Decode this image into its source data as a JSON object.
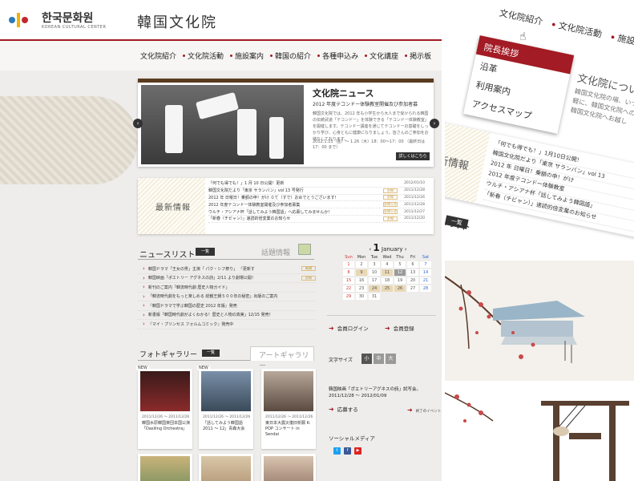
{
  "header": {
    "logo_ko": "한국문화원",
    "logo_en": "KOREAN CULTURAL CENTER",
    "title": "韓国文化院"
  },
  "nav": [
    "文化院紹介",
    "文化院活動",
    "施設案内",
    "韓国の紹介",
    "各種申込み",
    "文化講座",
    "掲示板"
  ],
  "hero": {
    "title": "文化院ニュース",
    "subtitle": "2012 年度テコンドー体験教室開催及び参加者募",
    "body": "韓国文化院では、2012 年も小学生から大人まで受けられる韓国の伝統武道「テコンドー」を体験できる「テコンドー体験教室」を開催します。テコンドー講座を通じてテコンドーの基礎をしっかり学び、心身ともに健康になりましょう。皆さんのご参加をお待ちしております。",
    "date": "2012.1.13（金）～ 1.26（木）18：00～17：00 （最終日は 17：00 まで）",
    "button": "詳しくはこちら"
  },
  "latest": {
    "label": "最新情報",
    "items": [
      {
        "title": "「何でも得でも！」1 月 10 日公開！更新",
        "tag": "",
        "date": "2012/01/10"
      },
      {
        "title": "韓国文化院だより「東京 サランバン」vol 13 号発行",
        "tag": "お知",
        "date": "2011/12/28"
      },
      {
        "title": "2012 年 日曜日！乗額の申！がけ ０て（すで）おめでとうございます！",
        "tag": "お知",
        "date": "2011/12/26"
      },
      {
        "title": "2012 年度テコンドー体験教室開催及び参加者募集",
        "tag": "お知らせ",
        "date": "2011/12/28"
      },
      {
        "title": "ウルチ・アシアナ杯「話してみよう韓国語」へ応募してみませんか！",
        "tag": "お知らせ",
        "date": "2011/12/27"
      },
      {
        "title": "「新春（チビャン）」速読的倍変業のお知らせ",
        "tag": "お知",
        "date": "2011/12/20"
      }
    ]
  },
  "newslist": {
    "title": "ニュースリスト",
    "button": "一覧",
    "topic": "話題情報",
    "items": [
      {
        "title": "韓国ドラマ「王女の男」主演「 パク・シフ祭り」 『更新す",
        "tag": "新規"
      },
      {
        "title": "韓国映画「ポエトリー アグネスの詩」2/11 より劇場公開！",
        "tag": "お知"
      },
      {
        "title": "新刊のご案内「韓流時代劇 歴史人物ガイド」",
        "tag": ""
      },
      {
        "title": "「韓流時代劇をもっと楽しめる 総観王朝５００年の秘密」出版のご案内",
        "tag": ""
      },
      {
        "title": "『韓国ドラマで学ぶ韓国の歴史 2012 年版』発売",
        "tag": ""
      },
      {
        "title": "新書版「韓国時代劇がよくわかる！歴史と人物の真実」12/15 発売！",
        "tag": ""
      },
      {
        "title": "『マイ・プリンセス フォルムコミック』発売中",
        "tag": ""
      }
    ]
  },
  "calendar": {
    "day": "1",
    "month": "January",
    "weekdays": [
      "Sun",
      "Mon",
      "Tue",
      "Wed",
      "Thu",
      "Fri",
      "Sat"
    ],
    "days": [
      "",
      "",
      "",
      "",
      "",
      "",
      "",
      "1",
      "2",
      "3",
      "4",
      "5",
      "6",
      "7",
      "8",
      "9",
      "10",
      "11",
      "12",
      "13",
      "14",
      "15",
      "16",
      "17",
      "18",
      "19",
      "20",
      "21",
      "22",
      "23",
      "24",
      "25",
      "26",
      "27",
      "28",
      "29",
      "30",
      "31",
      "",
      "",
      "",
      ""
    ]
  },
  "sidebar": {
    "login": "会員ログイン",
    "register": "会員登録",
    "fontsize_label": "文字サイズ",
    "font_small": "小",
    "font_medium": "中",
    "font_large": "大",
    "event_text": "韓国映画「ポエトリーアグネスの詩」試写会。 2011/12/28 ～ 2012/01/09",
    "apply": "応募する",
    "finished": "終了のイベント",
    "social": "ソーシャルメディア"
  },
  "gallery": {
    "title": "フォトギャラリー",
    "button": "一覧",
    "art": "アートギャラリー",
    "cards": [
      {
        "new": "NEW",
        "date": "2011/12/26 ～ 2011/12/26",
        "title": "韓国水原韓国楽団本国公演「Dasiling Orchestra」"
      },
      {
        "new": "NEW",
        "date": "2011/12/26 ～ 2011/12/26",
        "title": "「話してみよう韓国語 2011 ～ 12」青森大会"
      },
      {
        "new": "",
        "date": "2011/12/26 ～ 2011/12/26",
        "title": "東日本大震災復旧祈願 K-POP コンサート in Sendai"
      }
    ]
  },
  "zoom": {
    "nav": [
      "文化院紹介",
      "文化院活動",
      "施設案内"
    ],
    "menu": [
      "院長挨拶",
      "沿革",
      "利用案内",
      "アクセスマップ"
    ],
    "about_title": "文化院について",
    "about_body": "韓国文化院の場、いつでもお気軽に、韓国文化院への情報で、韓国文化院へお越し",
    "latest_label": "最新情報",
    "latest_items": [
      "「何でも得でも！」1月10日公開！",
      "韓国文化院だより「東京 サランバン」vol 13",
      "2012 年 日曜日！乗額の申！がけ",
      "2012 年度テコンドー体験教室",
      "ウルチ・アシアナ杯「話してみよう韓国語」",
      "「新春（チビャン）」速読的倍変業のお知らせ"
    ],
    "newslist": "ニュースリスト",
    "newslist_btn": "一覧"
  }
}
